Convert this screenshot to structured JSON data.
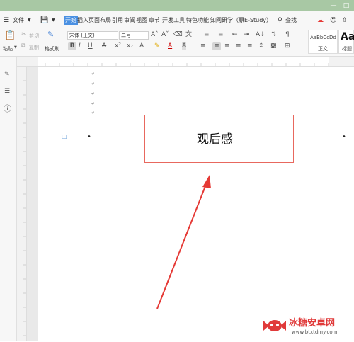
{
  "titlebar": {
    "accent": "#a8c8a4"
  },
  "menu": {
    "label": "文件",
    "tabs": [
      "开始",
      "插入",
      "页面布局",
      "引用",
      "审阅",
      "视图",
      "章节",
      "开发工具",
      "特色功能",
      "知网研学（原E-Study）"
    ],
    "active_tab": "开始",
    "search_label": "查找"
  },
  "ribbon": {
    "paste_label": "粘贴",
    "cut_label": "剪切",
    "copy_label": "复制",
    "format_painter_label": "格式刷",
    "font_name": "宋体 (正文)",
    "font_size": "二号",
    "styles": [
      {
        "preview": "AaBbCcDd",
        "label": "正文"
      },
      {
        "preview": "AaB",
        "label": "标题"
      }
    ]
  },
  "document": {
    "title": "观后感",
    "frame_color": "#e8685e",
    "arrow_color": "#e53935"
  },
  "watermark": {
    "brand": "冰糖安卓网",
    "url": "www.btxtdmy.com",
    "color": "#e03a3a"
  }
}
